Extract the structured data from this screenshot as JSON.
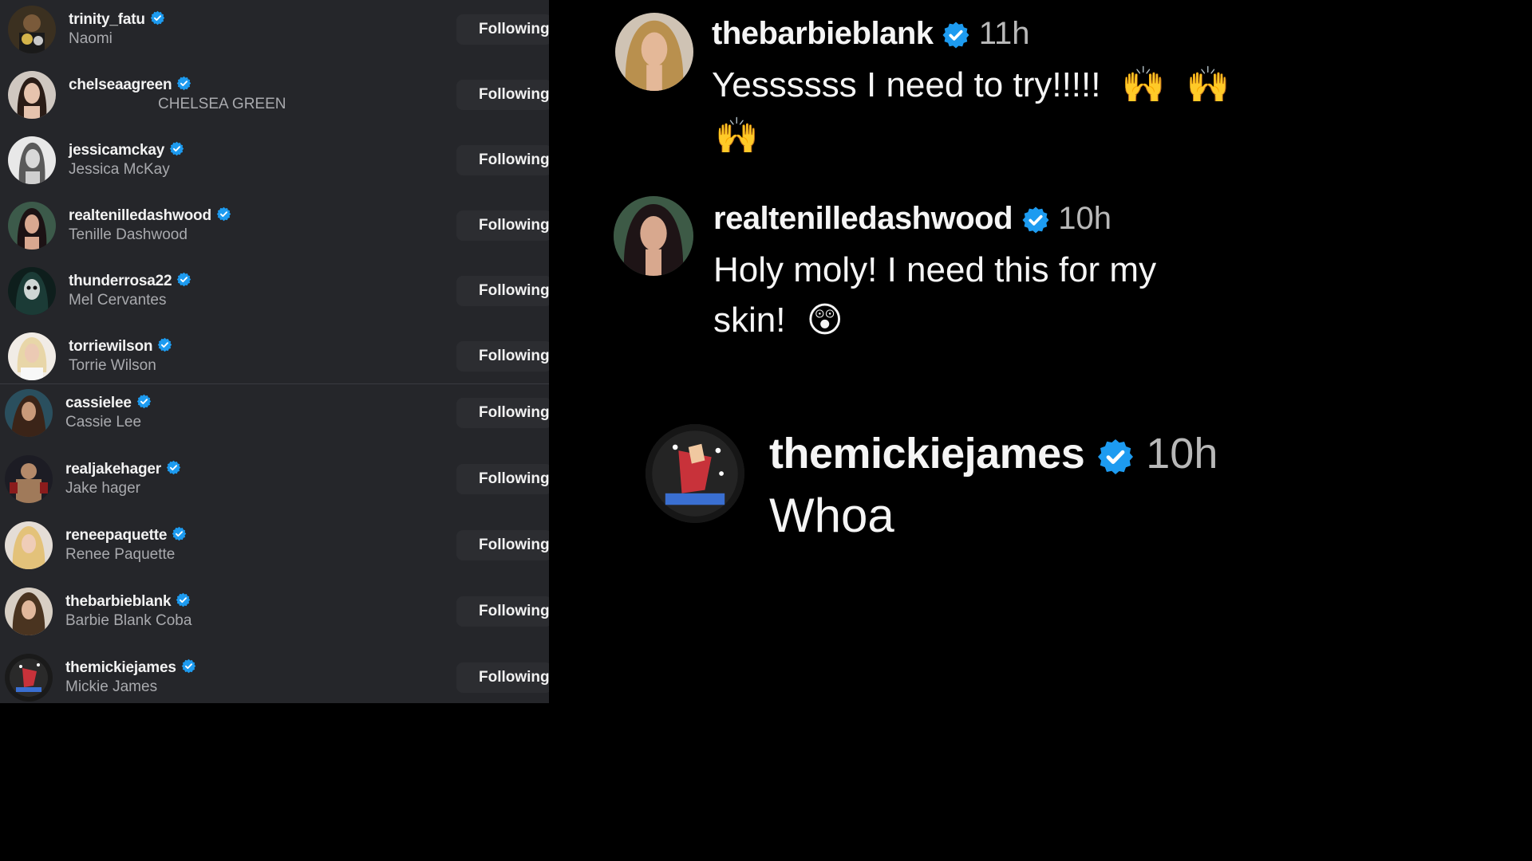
{
  "following": {
    "button_label": "Following",
    "accounts": [
      {
        "username": "trinity_fatu",
        "name": "Naomi"
      },
      {
        "username": "chelseaagreen",
        "name": "CHELSEA GREEN"
      },
      {
        "username": "jessicamckay",
        "name": "Jessica McKay"
      },
      {
        "username": "realtenilledashwood",
        "name": "Tenille Dashwood"
      },
      {
        "username": "thunderrosa22",
        "name": "Mel Cervantes"
      },
      {
        "username": "torriewilson",
        "name": "Torrie Wilson"
      },
      {
        "username": "cassielee",
        "name": "Cassie Lee"
      },
      {
        "username": "realjakehager",
        "name": "Jake hager"
      },
      {
        "username": "reneepaquette",
        "name": "Renee Paquette"
      },
      {
        "username": "thebarbieblank",
        "name": "Barbie Blank Coba"
      },
      {
        "username": "themickiejames",
        "name": "Mickie James"
      }
    ]
  },
  "comments": [
    {
      "username": "thebarbieblank",
      "time": "11h",
      "line1": "Yessssss I need to try!!!!!",
      "emoji": "🙌"
    },
    {
      "username": "realtenilledashwood",
      "time": "10h",
      "line1": "Holy moly! I need this for my",
      "line2": "skin!",
      "emoji": "😲"
    },
    {
      "username": "themickiejames",
      "time": "10h",
      "line1": "Whoa"
    }
  ],
  "colors": {
    "verified": "#1d9bf0",
    "panel_bg": "#25262a",
    "button_bg": "#2c2d31"
  }
}
